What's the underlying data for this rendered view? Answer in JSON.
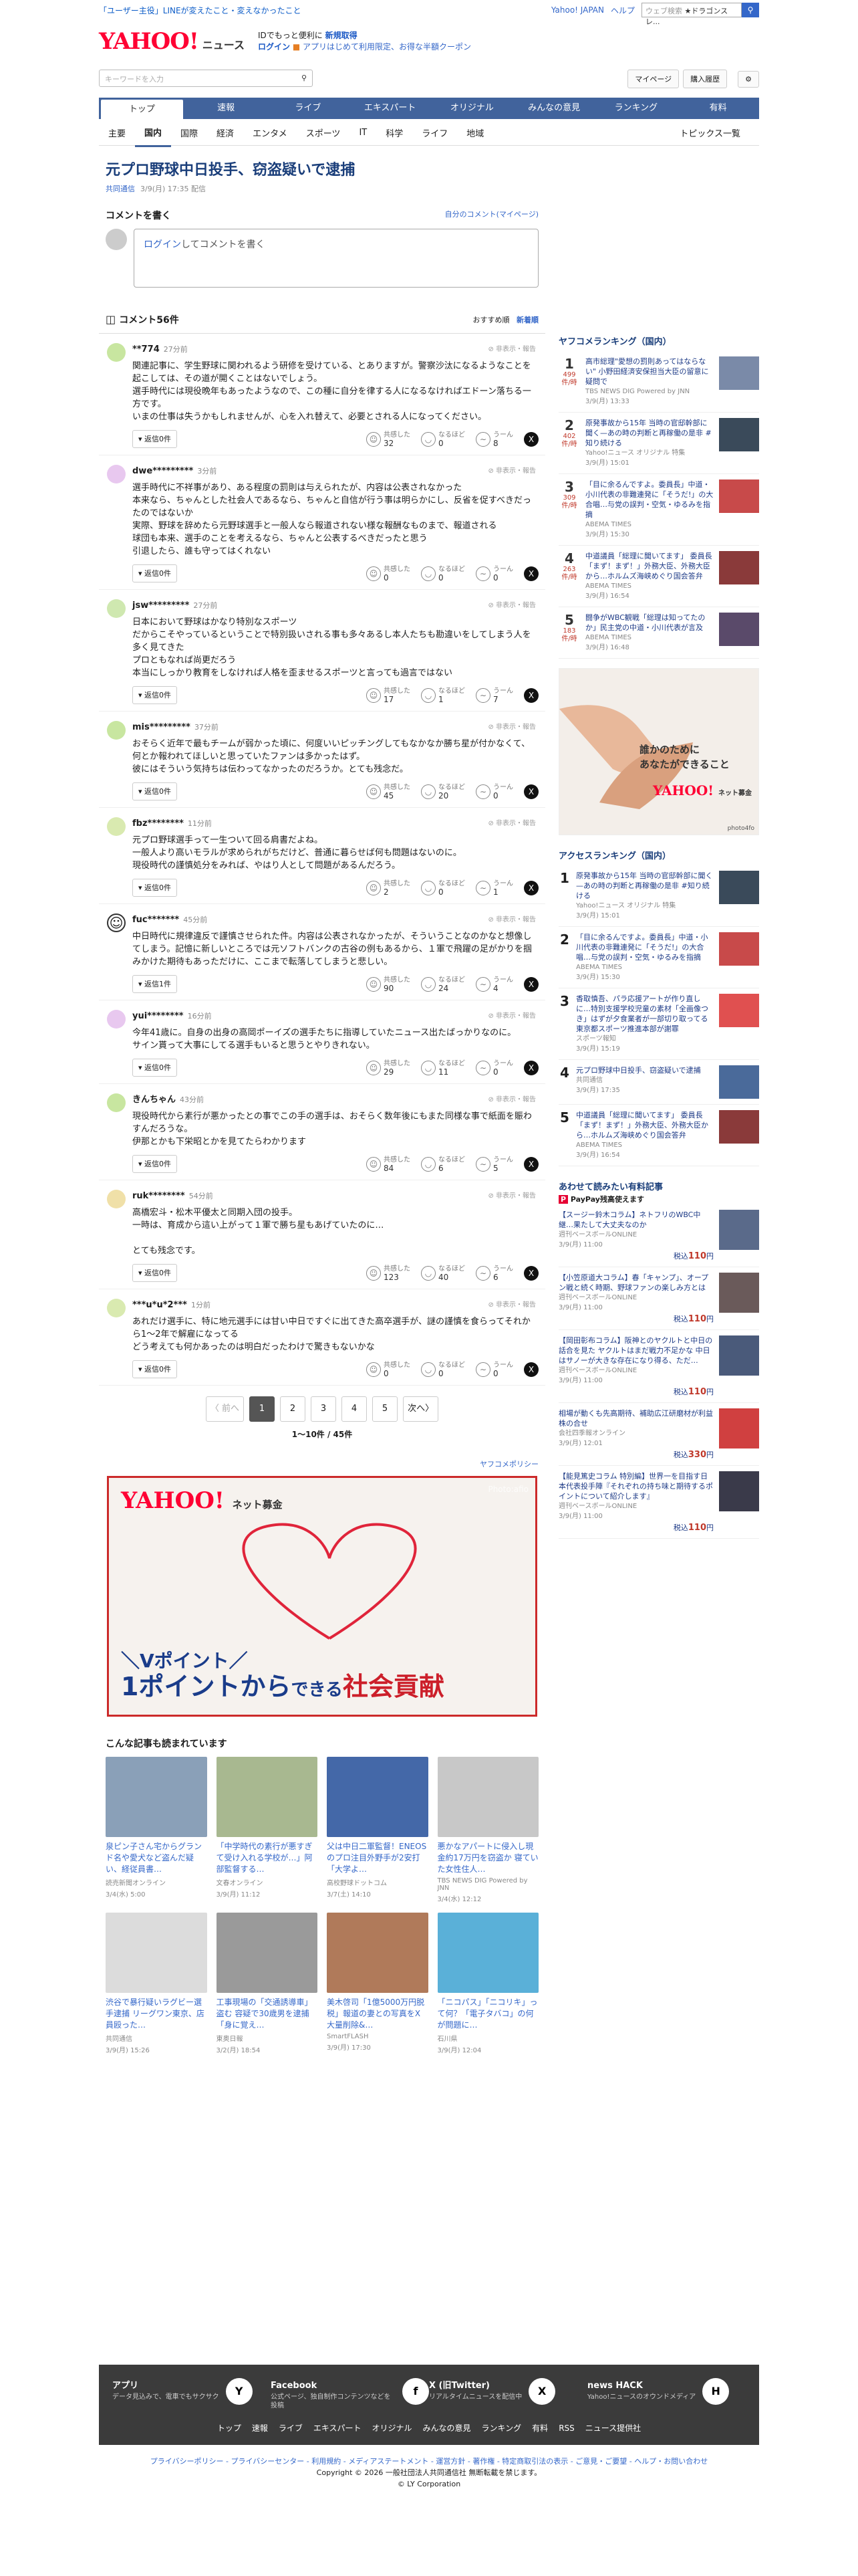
{
  "promo": {
    "text": "「ユーザー主役」LINEが変えたこと・変えなかったこと"
  },
  "toplinks": {
    "yjapan": "Yahoo! JAPAN",
    "help": "ヘルプ",
    "search_placeholder": "ウェブ検索",
    "search_hint": "★ドラゴンスレ..."
  },
  "header": {
    "logo": "YAHOO!",
    "logo_sub": "JAPAN",
    "service": "ニュース",
    "msg1": "IDでもっと便利に",
    "msg1b": "新規取得",
    "msg2a": "ログイン",
    "msg2": "アプリはじめて利用限定、お得な半額クーポン"
  },
  "search": {
    "placeholder": "キーワードを入力",
    "mypage": "マイページ",
    "purchased": "購入履歴"
  },
  "nav": [
    "トップ",
    "速報",
    "ライブ",
    "エキスパート",
    "オリジナル",
    "みんなの意見",
    "ランキング",
    "有料"
  ],
  "categories": [
    "主要",
    "国内",
    "国際",
    "経済",
    "エンタメ",
    "スポーツ",
    "IT",
    "科学",
    "ライフ",
    "地域"
  ],
  "topics_link": "トピックス一覧",
  "article": {
    "title": "元プロ野球中日投手、窃盗疑いで逮捕",
    "source": "共同通信",
    "time": "3/9(月) 17:35 配信"
  },
  "comment_write": {
    "heading": "コメントを書く",
    "my_comments": "自分のコメント(マイページ)",
    "box_link": "ログイン",
    "box_rest": "してコメントを書く"
  },
  "comments_header": {
    "count": "コメント56件",
    "sort1": "おすすめ順",
    "sort2": "新着順"
  },
  "report_label": "非表示・報告",
  "reaction_labels": {
    "a": "共感した",
    "b": "なるほど",
    "c": "うーん"
  },
  "comments": [
    {
      "name": "**774",
      "time": "27分前",
      "text": "関連記事に、学生野球に関われるよう研修を受けている、とありますが。警察沙汰になるようなことを起こしては、その道が開くことはないでしょう。\n選手時代には現役晩年もあったようなので、この種に自分を律する人になるなければエドーン落ちる一方です。\nいまの仕事は失うかもしれませんが、心を入れ替えて、必要とされる人になってください。",
      "replies": "返信0件",
      "r1": "32",
      "r2": "0",
      "r3": "8",
      "color": "#c8e6a0"
    },
    {
      "name": "dwe*********",
      "time": "3分前",
      "text": "選手時代に不祥事があり、ある程度の罰則は与えられたが、内容は公表されなかった\n本来なら、ちゃんとした社会人であるなら、ちゃんと自信が行う事は明らかにし、反省を促すべきだったのではないか\n実際、野球を辞めたら元野球選手と一般人なら報道されない様な報酬なものまで、報道される\n球団も本来、選手のことを考えるなら、ちゃんと公表するべきだったと思う\n引退したら、誰も守ってはくれない",
      "replies": "返信0件",
      "r1": "0",
      "r2": "0",
      "r3": "0",
      "color": "#e8c8ef"
    },
    {
      "name": "jsw*********",
      "time": "27分前",
      "text": "日本において野球はかなり特別なスポーツ\nだからこそやっているということで特別扱いされる事も多々あるし本人たちも勘違いをしてしまう人を多く見てきた\nプロともなれば尚更だろう\n本当にしっかり教育をしなければ人格を歪ませるスポーツと言っても過言ではない",
      "replies": "返信0件",
      "r1": "17",
      "r2": "1",
      "r3": "7",
      "color": "#cfe8b0"
    },
    {
      "name": "mis*********",
      "time": "37分前",
      "text": "おそらく近年で最もチームが弱かった頃に、何度いいピッチングしてもなかなか勝ち星が付かなくて、何とか報われてほしいと思っていたファンは多かったはず。\n彼にはそういう気持ちは伝わってなかったのだろうか。とても残念だ。",
      "replies": "返信0件",
      "r1": "45",
      "r2": "20",
      "r3": "0",
      "color": "#c8e6a0"
    },
    {
      "name": "fbz********",
      "time": "11分前",
      "text": "元プロ野球選手って一生ついて回る肩書だよね。\n一般人より高いモラルが求められがちだけど、普通に暮らせば何も問題はないのに。\n現役時代の謹慎処分をみれば、やはり人として問題があるんだろう。",
      "replies": "返信0件",
      "r1": "2",
      "r2": "0",
      "r3": "1",
      "color": "#d9eab0"
    },
    {
      "name": "fuc*******",
      "time": "45分前",
      "text": "中日時代に規律違反で謹慎させられた件。内容は公表されなかったが、そういうことなのかなと想像してしまう。記憶に新しいところでは元ソフトバンクの古谷の例もあるから、１軍で飛躍の足がかりを掴みかけた期待もあっただけに、ここまで転落してしまうと悲しい。",
      "replies": "返信1件",
      "r1": "90",
      "r2": "24",
      "r3": "4",
      "color": "#ffffff"
    },
    {
      "name": "yui********",
      "time": "16分前",
      "text": "今年41歳に。自身の出身の高岡ポーイズの選手たちに指導していたニュース出たばっかりなのに。\nサイン貰って大事にしてる選手もいると思うとやりきれない。",
      "replies": "返信0件",
      "r1": "29",
      "r2": "11",
      "r3": "0",
      "color": "#e8c8ef"
    },
    {
      "name": "きんちゃん",
      "time": "43分前",
      "text": "現役時代から素行が悪かったとの事でこの手の選手は、おそらく数年後にもまた同様な事で紙面を賑わすんだろうな。\n伊那とかも下栄昭とかを見てたらわかります",
      "replies": "返信0件",
      "r1": "84",
      "r2": "6",
      "r3": "5",
      "color": "#c8e6a0"
    },
    {
      "name": "ruk********",
      "time": "54分前",
      "text": "高橋宏斗・松木平優太と同期入団の投手。\n一時は、育成から這い上がって１軍で勝ち星もあげていたのに…\n\nとても残念です。",
      "replies": "返信0件",
      "r1": "123",
      "r2": "40",
      "r3": "6",
      "color": "#f0e0a8"
    },
    {
      "name": "***u*u*2***",
      "time": "1分前",
      "text": "あれだけ選手に、特に地元選手には甘い中日ですぐに出てきた高卒選手が、謎の謹慎を食らってそれから1〜2年で解雇になってる\nどう考えても何かあったのは明白だったわけで驚きもないかな",
      "replies": "返信0件",
      "r1": "0",
      "r2": "0",
      "r3": "0",
      "color": "#d9eab0"
    }
  ],
  "pager": {
    "prev": "〈 前へ",
    "pages": [
      "1",
      "2",
      "3",
      "4",
      "5"
    ],
    "next": "次へ〉",
    "count": "1〜10件 / 45件"
  },
  "policy_link": "ヤフコメポリシー",
  "big_ad": {
    "logo": "YAHOO!",
    "logo_sub": "JAPAN",
    "label": "ネット募金",
    "photo_credit": "Photo:afio",
    "line1": "＼Vポイント／",
    "line2a": "1ポイントから",
    "line2b": "できる",
    "line2c": "社会貢献"
  },
  "read_heading": "こんな記事も読まれています",
  "cards": [
    {
      "title": "泉ピン子さん宅からグランド名や愛犬など盗んだ疑い、経従員書…",
      "src": "読売新聞オンライン",
      "time": "3/4(水) 5:00",
      "color": "#8aa0b8"
    },
    {
      "title": "「中学時代の素行が悪すぎて受け入れる学校が…」阿部監督する…",
      "src": "文春オンライン",
      "time": "3/9(月) 11:12",
      "color": "#a8b890"
    },
    {
      "title": "父は中日二軍監督！ENEOSのプロ注目外野手が2安打「大学よ…",
      "src": "高校野球ドットコム",
      "time": "3/7(土) 14:10",
      "color": "#4468a8"
    },
    {
      "title": "悪かなアパートに侵入し現金約17万円を窃盗か 寝ていた女性住人…",
      "src": "TBS NEWS DIG Powered by JNN",
      "time": "3/4(水) 12:12",
      "color": "#c8c8c8"
    },
    {
      "title": "渋谷で暴行疑いラグビー選手逮捕 リーグワン東京、店員殴った…",
      "src": "共同通信",
      "time": "3/9(月) 15:26",
      "color": "#dcdcdc"
    },
    {
      "title": "工事現場の「交通誘導車」盗む 容疑で30歳男を逮捕「身に覚え…",
      "src": "東奥日報",
      "time": "3/2(月) 18:54",
      "color": "#9a9a9a"
    },
    {
      "title": "美木啓司「1億5000万円脱税」報道の妻との写真をX大量削除&…",
      "src": "SmartFLASH",
      "time": "3/9(月) 17:30",
      "color": "#b07a5a"
    },
    {
      "title": "「ニコパス」「ニコリキ」って何？「電子タバコ」の何が問題に…",
      "src": "石川県",
      "time": "3/9(月) 12:04",
      "color": "#5ab0d8"
    }
  ],
  "side": {
    "ranking_title": "ヤフコメランキング（国内）",
    "ranking": [
      {
        "n": "1",
        "count": "499",
        "unit": "件/時",
        "title": "高市総理\"愛想の罰則あってはならない\" 小野田経済安保担当大臣の留意に疑問で",
        "src": "TBS NEWS DIG Powered by JNN",
        "time": "3/9(月) 13:33",
        "color": "#7a8aa8"
      },
      {
        "n": "2",
        "count": "402",
        "unit": "件/時",
        "title": "原発事故から15年 当時の官邸幹部に聞く—あの時の判断と再稼働の是非 #知り続ける",
        "src": "Yahoo!ニュース オリジナル 特集",
        "time": "3/9(月) 15:01",
        "color": "#3a4a5a"
      },
      {
        "n": "3",
        "count": "309",
        "unit": "件/時",
        "title": "「目に余るんですよ。委員長」中道・小川代表の非難連発に「そうだ!」の大合唱…与党の誤判・空気・ゆるみを指摘",
        "src": "ABEMA TIMES",
        "time": "3/9(月) 15:30",
        "color": "#c84a4a"
      },
      {
        "n": "4",
        "count": "263",
        "unit": "件/時",
        "title": "中道議員「総理に聞いてます」 委員長「まず！まず！」外務大臣、外務大臣から…ホルムズ海峡めぐり国会答弁",
        "src": "ABEMA TIMES",
        "time": "3/9(月) 16:54",
        "color": "#8a3a3a"
      },
      {
        "n": "5",
        "count": "183",
        "unit": "件/時",
        "title": "闘争がWBC観戦「総理は知ってたのか」民主党の中道・小川代表が言及",
        "src": "ABEMA TIMES",
        "time": "3/9(月) 16:48",
        "color": "#5a4a6a"
      }
    ],
    "ad_text1": "誰かのために",
    "ad_text2": "あなたができること",
    "ad_logo": "YAHOO!",
    "ad_label": "ネット募金",
    "ad_credit": "photo4fo",
    "access_title": "アクセスランキング（国内）",
    "access": [
      {
        "n": "1",
        "title": "原発事故から15年 当時の官邸幹部に聞く—あの時の判断と再稼働の是非 #知り続ける",
        "src": "Yahoo!ニュース オリジナル 特集",
        "time": "3/9(月) 15:01",
        "color": "#3a4a5a"
      },
      {
        "n": "2",
        "title": "「目に余るんですよ。委員長」中道・小川代表の非難連発に「そうだ!」の大合唱…与党の誤判・空気・ゆるみを指摘",
        "src": "ABEMA TIMES",
        "time": "3/9(月) 15:30",
        "color": "#c84a4a"
      },
      {
        "n": "3",
        "title": "香取慎吾、パラ応援アートが作り直しに…特別支援学校児童の素材「全画像つき」はずが夕食業者が一部切り取ってる 東京都スポーツ推進本部が謝罪",
        "src": "スポーツ報知",
        "time": "3/9(月) 15:19",
        "color": "#e05050"
      },
      {
        "n": "4",
        "title": "元プロ野球中日投手、窃盗疑いで逮捕",
        "src": "共同通信",
        "time": "3/9(月) 17:35",
        "color": "#4a6a9a"
      },
      {
        "n": "5",
        "title": "中道議員「総理に聞いてます」 委員長「まず！まず！」外務大臣、外務大臣から…ホルムズ海峡めぐり国会答弁",
        "src": "ABEMA TIMES",
        "time": "3/9(月) 16:54",
        "color": "#8a3a3a"
      }
    ],
    "paid_title": "あわせて読みたい有料記事",
    "paid_sub": "PayPay残高使えます",
    "paid": [
      {
        "title": "【スージー鈴木コラム】ネトフリのWBC中継…果たして大丈夫なのか",
        "src": "週刊ベースボールONLINE",
        "time": "3/9(月) 11:00",
        "price": "110",
        "color": "#5a6a8a"
      },
      {
        "title": "【小笠原道大コラム】春「キャンプ」、オープン戦と続く時期、野球ファンの楽しみ方とは",
        "src": "週刊ベースボールONLINE",
        "time": "3/9(月) 11:00",
        "price": "110",
        "color": "#6a5a5a"
      },
      {
        "title": "【岡田彰布コラム】阪神とのヤクルトと中日の話合を見た ヤクルトはまだ戦力不足かな 中日はサノーが大きな存在になり得る、ただ…",
        "src": "週刊ベースボールONLINE",
        "time": "3/9(月) 11:00",
        "price": "110",
        "color": "#4a5a7a"
      },
      {
        "title": "相場が動くも先高期待、補助広江研磨材が利益株の合せ",
        "src": "会社四季報オンライン",
        "time": "3/9(月) 12:01",
        "price": "330",
        "color": "#d04040"
      },
      {
        "title": "【能見篤史コラム 特別編】世界一を目指す日本代表投手陣『それぞれの持ち味と期待するポイントについて紹介します』",
        "src": "週刊ベースボールONLINE",
        "time": "3/9(月) 11:00",
        "price": "110",
        "color": "#3a3a4a"
      }
    ],
    "price_prefix": "税込",
    "price_unit": "円"
  },
  "apps": [
    {
      "title": "アプリ",
      "desc": "データ見込みで、電車でもサクサク",
      "icon": "Y"
    },
    {
      "title": "Facebook",
      "desc": "公式ページ、独自制作コンテンツなどを投稿",
      "icon": "f"
    },
    {
      "title": "X (旧Twitter)",
      "desc": "リアルタイムニュースを配信中",
      "icon": "X"
    },
    {
      "title": "news HACK",
      "desc": "Yahoo!ニュースのオウンドメディア",
      "icon": "H"
    }
  ],
  "footer_nav": [
    "トップ",
    "速報",
    "ライブ",
    "エキスパート",
    "オリジナル",
    "みんなの意見",
    "ランキング",
    "有料",
    "RSS",
    "ニュース提供社"
  ],
  "legal": {
    "links": "プライバシーポリシー - プライバシーセンター - 利用規約 - メディアステートメント - 運営方針 - 著作権 - 特定商取引法の表示 - ご意見・ご要望 - ヘルプ・お問い合わせ",
    "copyright": "Copyright © 2026 一般社団法人共同通信社 無断転載を禁じます。",
    "corp": "© LY Corporation"
  }
}
